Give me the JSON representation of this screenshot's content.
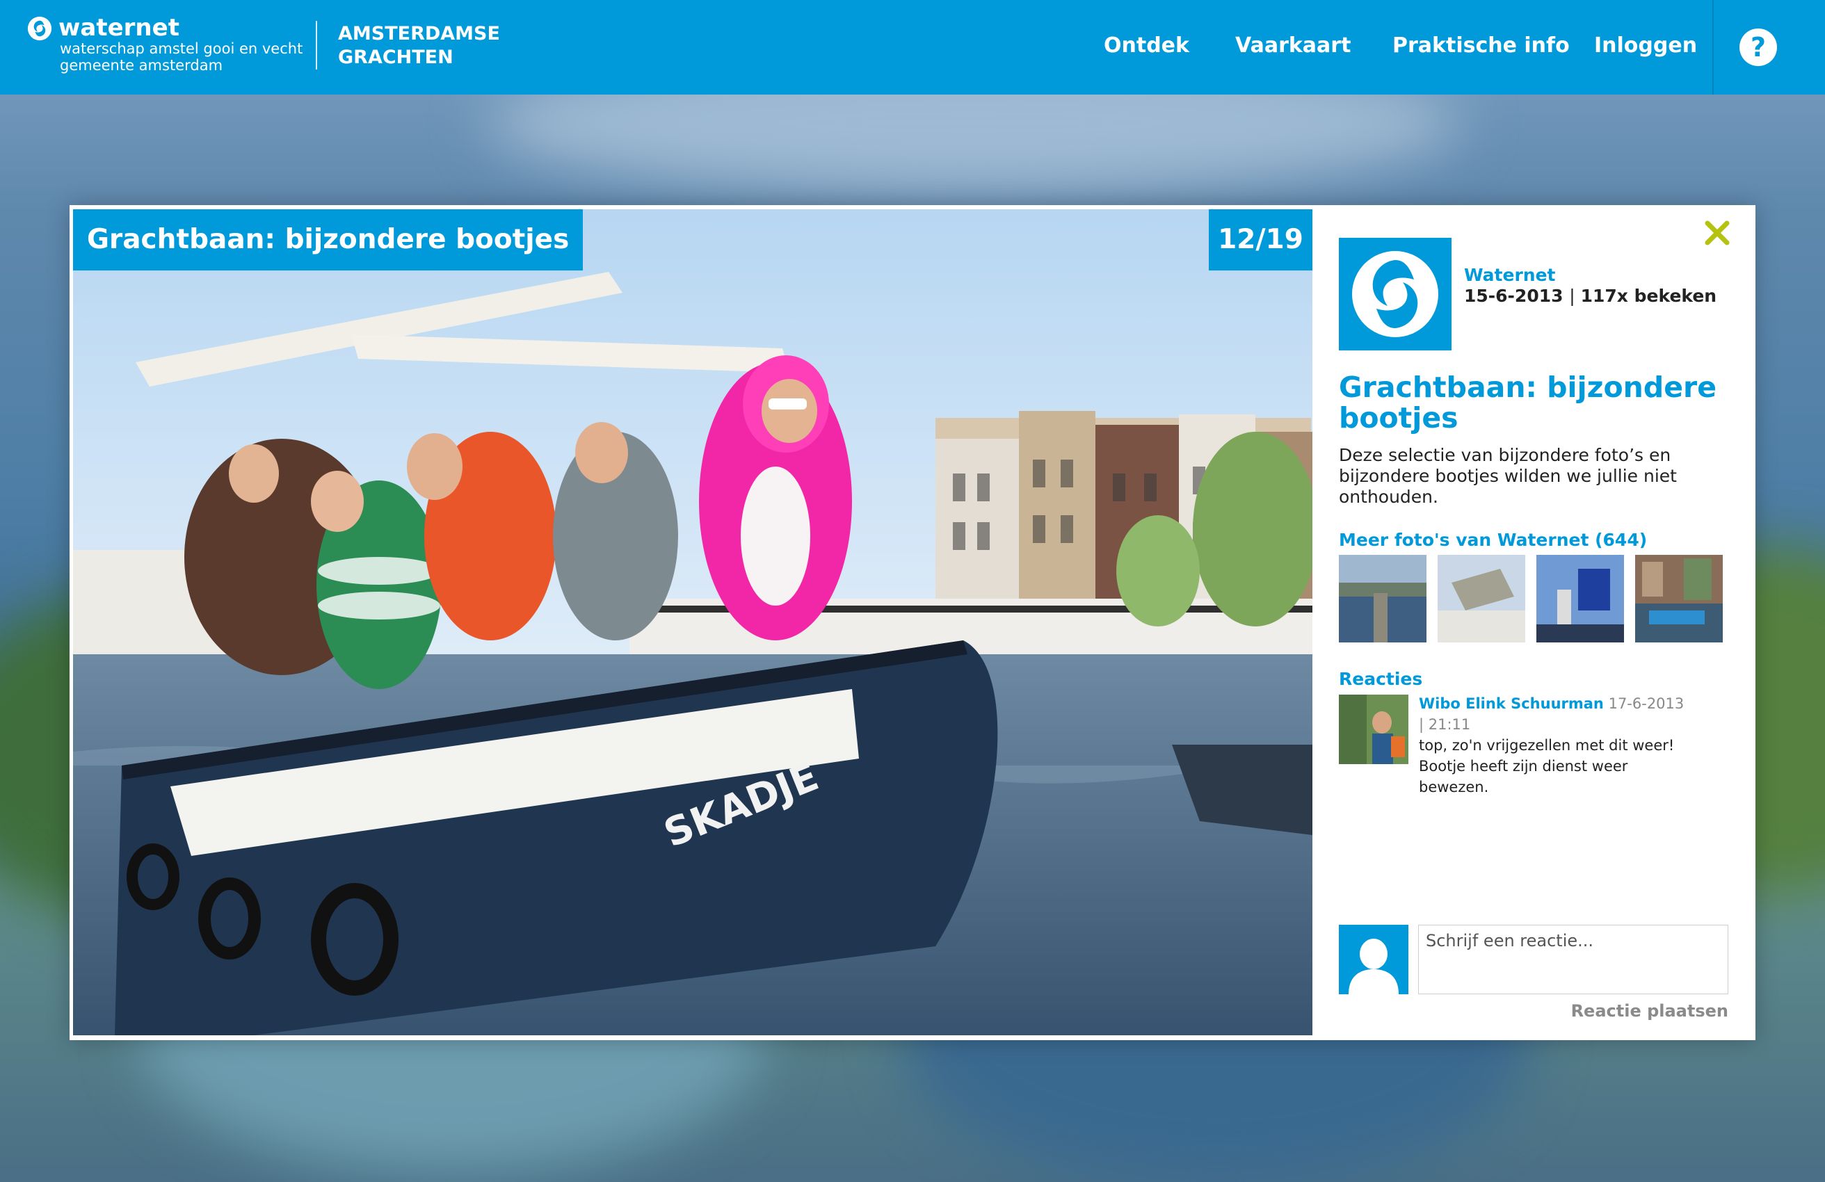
{
  "header": {
    "logo_name": "waternet",
    "logo_sub1": "waterschap amstel gooi en vecht",
    "logo_sub2": "gemeente amsterdam",
    "site_title_line1": "AMSTERDAMSE",
    "site_title_line2": "GRACHTEN",
    "nav": [
      "Ontdek",
      "Vaarkaart",
      "Praktische info",
      "Inloggen"
    ],
    "help_icon": "question-circle-icon"
  },
  "photo": {
    "title": "Grachtbaan: bijzondere bootjes",
    "counter": "12/19",
    "boat_name": "SKADJE"
  },
  "sidebar": {
    "owner_name": "Waternet",
    "owner_date": "15-6-2013",
    "owner_views": "117x bekeken",
    "title": "Grachtbaan: bijzondere bootjes",
    "description": "Deze selectie van bijzondere foto’s en bijzondere bootjes wilden we jullie niet onthouden.",
    "more_link": "Meer foto's van Waternet (644)",
    "reactions_heading": "Reacties",
    "comments": [
      {
        "author": "Wibo Elink Schuurman",
        "date": "17-6-2013 | 21:11",
        "text": "top, zo'n vrijgezellen met dit weer! Bootje heeft zijn dienst weer bewezen."
      }
    ],
    "reply_placeholder": "Schrijf een reactie...",
    "reply_button": "Reactie plaatsen"
  },
  "colors": {
    "brand_blue": "#0099da",
    "close_icon": "#b5c20f",
    "text_dark": "#222222"
  }
}
